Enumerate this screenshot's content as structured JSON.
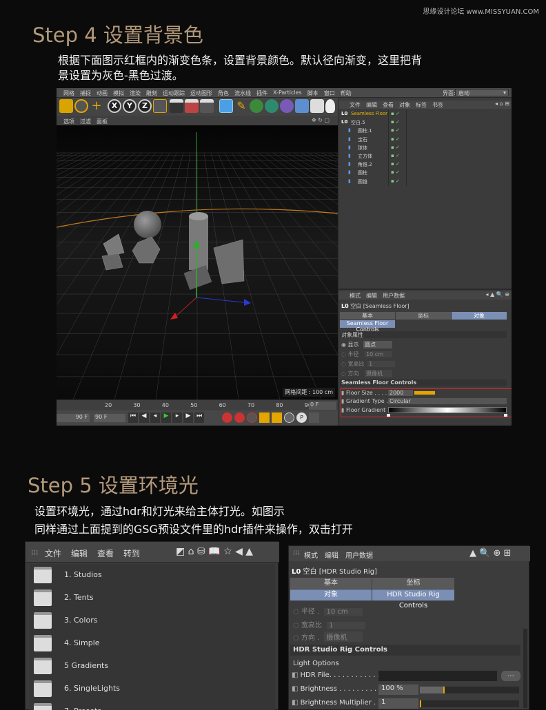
{
  "watermark": "思缘设计论坛 www.MISSYUAN.COM",
  "step4": {
    "title": "Step 4 设置背景色",
    "desc_line1": "根据下面图示红框内的渐变色条，设置背景颜色。默认径向渐变，这里把背",
    "desc_line2": "景设置为灰色-黑色过渡。"
  },
  "c4d": {
    "menus": [
      "网格",
      "捕捉",
      "动画",
      "模拟",
      "渲染",
      "雕刻",
      "运动跟踪",
      "运动图形",
      "角色",
      "流水线",
      "插件",
      "X-Particles",
      "脚本",
      "窗口",
      "帮助"
    ],
    "layout_label": "界面:",
    "layout_value": "启动",
    "toolbar_icons": [
      "cube-icon",
      "rotate-icon",
      "move-icon",
      "x-axis-icon",
      "y-axis-icon",
      "z-axis-icon",
      "coord-icon",
      "clapper-icon",
      "render-view-icon",
      "render-settings-icon",
      "primitive-cube-icon",
      "pen-icon",
      "subdivision-icon",
      "array-icon",
      "deformer-icon",
      "floor-icon",
      "camera-icon",
      "light-icon"
    ],
    "viewport_menus": [
      "选项",
      "过滤",
      "面板"
    ],
    "grid_spacing": "网格间距 : 100 cm",
    "om_menus": [
      "文件",
      "编辑",
      "查看",
      "对象",
      "标签",
      "书签"
    ],
    "objects": [
      {
        "name": "Seamless Floor",
        "icon": "L0",
        "active": true
      },
      {
        "name": "空白.5",
        "icon": "L0",
        "active": false
      },
      {
        "name": "圆柱.1",
        "icon": "cyl",
        "active": false
      },
      {
        "name": "宝石",
        "icon": "gem",
        "active": false
      },
      {
        "name": "球体",
        "icon": "sph",
        "active": false
      },
      {
        "name": "立方体",
        "icon": "cube",
        "active": false
      },
      {
        "name": "角锥.2",
        "icon": "pyr",
        "active": false
      },
      {
        "name": "圆柱",
        "icon": "cyl",
        "active": false
      },
      {
        "name": "圆锥",
        "icon": "cone",
        "active": false
      }
    ],
    "attr_menus": [
      "模式",
      "编辑",
      "用户数据"
    ],
    "attr_title": "空白 [Seamless Floor]",
    "attr_tabs": [
      "基本",
      "坐标",
      "对象"
    ],
    "attr_subtab": "Seamless Floor Controls",
    "obj_props": "对象属性",
    "display_label": "显示",
    "display_value": "圆点",
    "radius_label": "半径",
    "radius_value": "10 cm",
    "aspect_label": "宽高比",
    "aspect_value": "1",
    "orient_label": "方向",
    "orient_value": "摄像机",
    "sfc_header": "Seamless Floor Controls",
    "floor_size_label": "Floor Size . . . . . .",
    "floor_size_value": "2000",
    "grad_type_label": "Gradient Type . .",
    "grad_type_value": "Circular",
    "floor_grad_label": "Floor Gradient",
    "timeline_ticks": [
      "20",
      "30",
      "40",
      "50",
      "60",
      "70",
      "80",
      "90"
    ],
    "frame_end1": "0 F",
    "frame_a": "90 F",
    "frame_b": "90 F",
    "colors": {
      "selection": "#e6b800",
      "highlight_border": "#d9292f",
      "tab_active": "#7b8fb5"
    }
  },
  "step5": {
    "title": "Step 5  设置环境光",
    "desc_line1": "设置环境光，通过hdr和灯光来给主体打光。如图示",
    "desc_line2": "同样通过上面提到的GSG预设文件里的hdr插件来操作，双击打开"
  },
  "browser": {
    "menus": [
      "文件",
      "编辑",
      "查看",
      "转到"
    ],
    "items": [
      "1. Studios",
      "2. Tents",
      "3. Colors",
      "4. Simple",
      "5 Gradients",
      "6. SingleLights",
      "7. Presets"
    ]
  },
  "hdr": {
    "menus": [
      "模式",
      "编辑",
      "用户数据"
    ],
    "title": "空白 [HDR Studio Rig]",
    "tabs": [
      "基本",
      "坐标",
      "对象",
      "HDR Studio Rig Controls"
    ],
    "radius_label": "半径 .",
    "radius_value": "10 cm",
    "aspect_label": "宽高比",
    "aspect_value": "1",
    "orient_label": "方向 .",
    "orient_value": "摄像机",
    "section": "HDR Studio Rig Controls",
    "light_options": "Light Options",
    "hdr_file_label": "HDR File. . . . . . . . . . . .",
    "browse_label": "...",
    "brightness_label": "Brightness . . . . . . . . . . .",
    "brightness_value": "100 %",
    "brightness_mult_label": "Brightness Multiplier . .",
    "brightness_mult_value": "1",
    "brightness_pct": 0.25
  }
}
